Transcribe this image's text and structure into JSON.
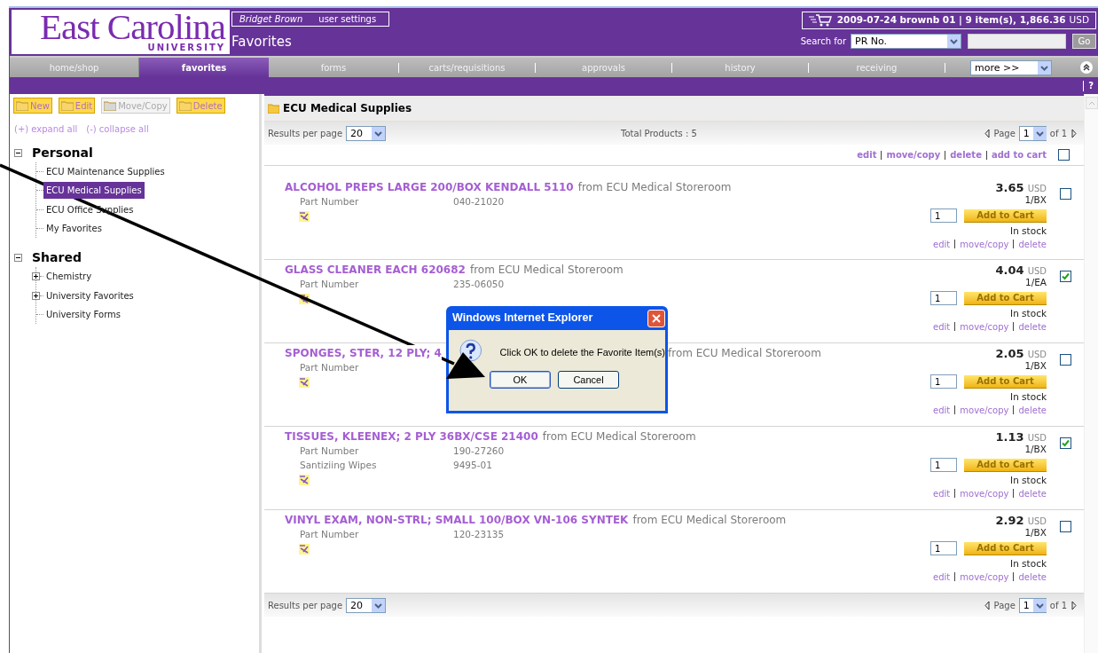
{
  "header": {
    "logo": {
      "name": "East Carolina",
      "sub": "UNIVERSITY"
    },
    "user": "Bridget Brown",
    "user_settings": "user settings",
    "page_title": "Favorites",
    "cart": {
      "summary": "2009-07-24 brownb 01 | 9 item(s), 1,866.36",
      "currency": "USD"
    },
    "search": {
      "label": "Search for",
      "type": "PR No.",
      "button": "Go"
    }
  },
  "nav": {
    "tabs": [
      {
        "label": "home/shop",
        "selected": false
      },
      {
        "label": "favorites",
        "selected": true
      },
      {
        "label": "forms",
        "selected": false
      },
      {
        "label": "carts/requisitions",
        "selected": false
      },
      {
        "label": "approvals",
        "selected": false
      },
      {
        "label": "history",
        "selected": false
      },
      {
        "label": "receiving",
        "selected": false
      }
    ],
    "more": "more >>",
    "help": "?"
  },
  "sidebar": {
    "toolbar": [
      {
        "label": "New",
        "disabled": false
      },
      {
        "label": "Edit",
        "disabled": false
      },
      {
        "label": "Move/Copy",
        "disabled": true
      },
      {
        "label": "Delete",
        "disabled": false
      }
    ],
    "expand_all": "(+) expand all",
    "collapse_all": "(-) collapse all",
    "groups": [
      {
        "label": "Personal",
        "expanded": true,
        "children": [
          {
            "label": "ECU Maintenance Supplies",
            "kind": "leaf",
            "selected": false
          },
          {
            "label": "ECU Medical Supplies",
            "kind": "leaf",
            "selected": true
          },
          {
            "label": "ECU Office Supplies",
            "kind": "leaf",
            "selected": false
          },
          {
            "label": "My Favorites",
            "kind": "leaf",
            "selected": false
          }
        ]
      },
      {
        "label": "Shared",
        "expanded": true,
        "children": [
          {
            "label": "Chemistry",
            "kind": "folder",
            "selected": false
          },
          {
            "label": "University Favorites",
            "kind": "folder",
            "selected": false
          },
          {
            "label": "University Forms",
            "kind": "leaf",
            "selected": false
          }
        ]
      }
    ]
  },
  "main": {
    "title": "ECU Medical Supplies",
    "pagers": [
      {
        "results_label": "Results per page",
        "results_value": "20",
        "total": "Total Products : 5",
        "page_label": "Page",
        "page_value": "1",
        "page_of": "of 1"
      },
      {
        "results_label": "Results per page",
        "results_value": "20",
        "page_label": "Page",
        "page_value": "1",
        "page_of": "of 1"
      }
    ],
    "bulk_actions": [
      "edit",
      "move/copy",
      "delete",
      "add to cart"
    ],
    "select_all_checked": false,
    "products": [
      {
        "kind": "plain",
        "name": "ALCOHOL PREPS LARGE 200/BOX KENDALL 5110",
        "source": "from ECU Medical Storeroom",
        "details": [
          {
            "label": "Part Number",
            "value": "040-21020"
          }
        ],
        "price": "3.65",
        "currency": "USD",
        "unit": "1/BX",
        "qty": "1",
        "add": "Add to Cart",
        "stock": "In stock",
        "actions": [
          "edit",
          "move/copy",
          "delete"
        ],
        "checked": false
      },
      {
        "kind": "plain",
        "name": "GLASS CLEANER EACH 620682",
        "source": "from ECU Medical Storeroom",
        "details": [
          {
            "label": "Part Number",
            "value": "235-06050"
          }
        ],
        "price": "4.04",
        "currency": "USD",
        "unit": "1/EA",
        "qty": "1",
        "add": "Add to Cart",
        "stock": "In stock",
        "actions": [
          "edit",
          "move/copy",
          "delete"
        ],
        "checked": true
      },
      {
        "kind": "covered",
        "name": "SPONGES, STER, 12 PLY; 4",
        "source": "from ECU Medical Storeroom",
        "details": [
          {
            "label": "Part Number"
          }
        ],
        "price": "2.05",
        "currency": "USD",
        "unit": "1/BX",
        "qty": "1",
        "add": "Add to Cart",
        "stock": "In stock",
        "actions": [
          "edit",
          "move/copy",
          "delete"
        ],
        "checked": false
      },
      {
        "kind": "plain",
        "name": "TISSUES, KLEENEX; 2 PLY 36BX/CSE 21400",
        "source": "from ECU Medical Storeroom",
        "details": [
          {
            "label": "Part Number",
            "value": "190-27260"
          },
          {
            "label": "Santiziing Wipes",
            "value": "9495-01"
          }
        ],
        "price": "1.13",
        "currency": "USD",
        "unit": "1/BX",
        "qty": "1",
        "add": "Add to Cart",
        "stock": "In stock",
        "actions": [
          "edit",
          "move/copy",
          "delete"
        ],
        "checked": true
      },
      {
        "kind": "plain",
        "name": "VINYL EXAM, NON-STRL; SMALL 100/BOX VN-106 SYNTEK",
        "source": "from ECU Medical Storeroom",
        "details": [
          {
            "label": "Part Number",
            "value": "120-23135"
          }
        ],
        "price": "2.92",
        "currency": "USD",
        "unit": "1/BX",
        "qty": "1",
        "add": "Add to Cart",
        "stock": "In stock",
        "actions": [
          "edit",
          "move/copy",
          "delete"
        ],
        "checked": false
      }
    ]
  },
  "dialog": {
    "title": "Windows Internet Explorer",
    "message": "Click OK to delete the Favorite Item(s)",
    "buttons": [
      "OK",
      "Cancel"
    ]
  }
}
